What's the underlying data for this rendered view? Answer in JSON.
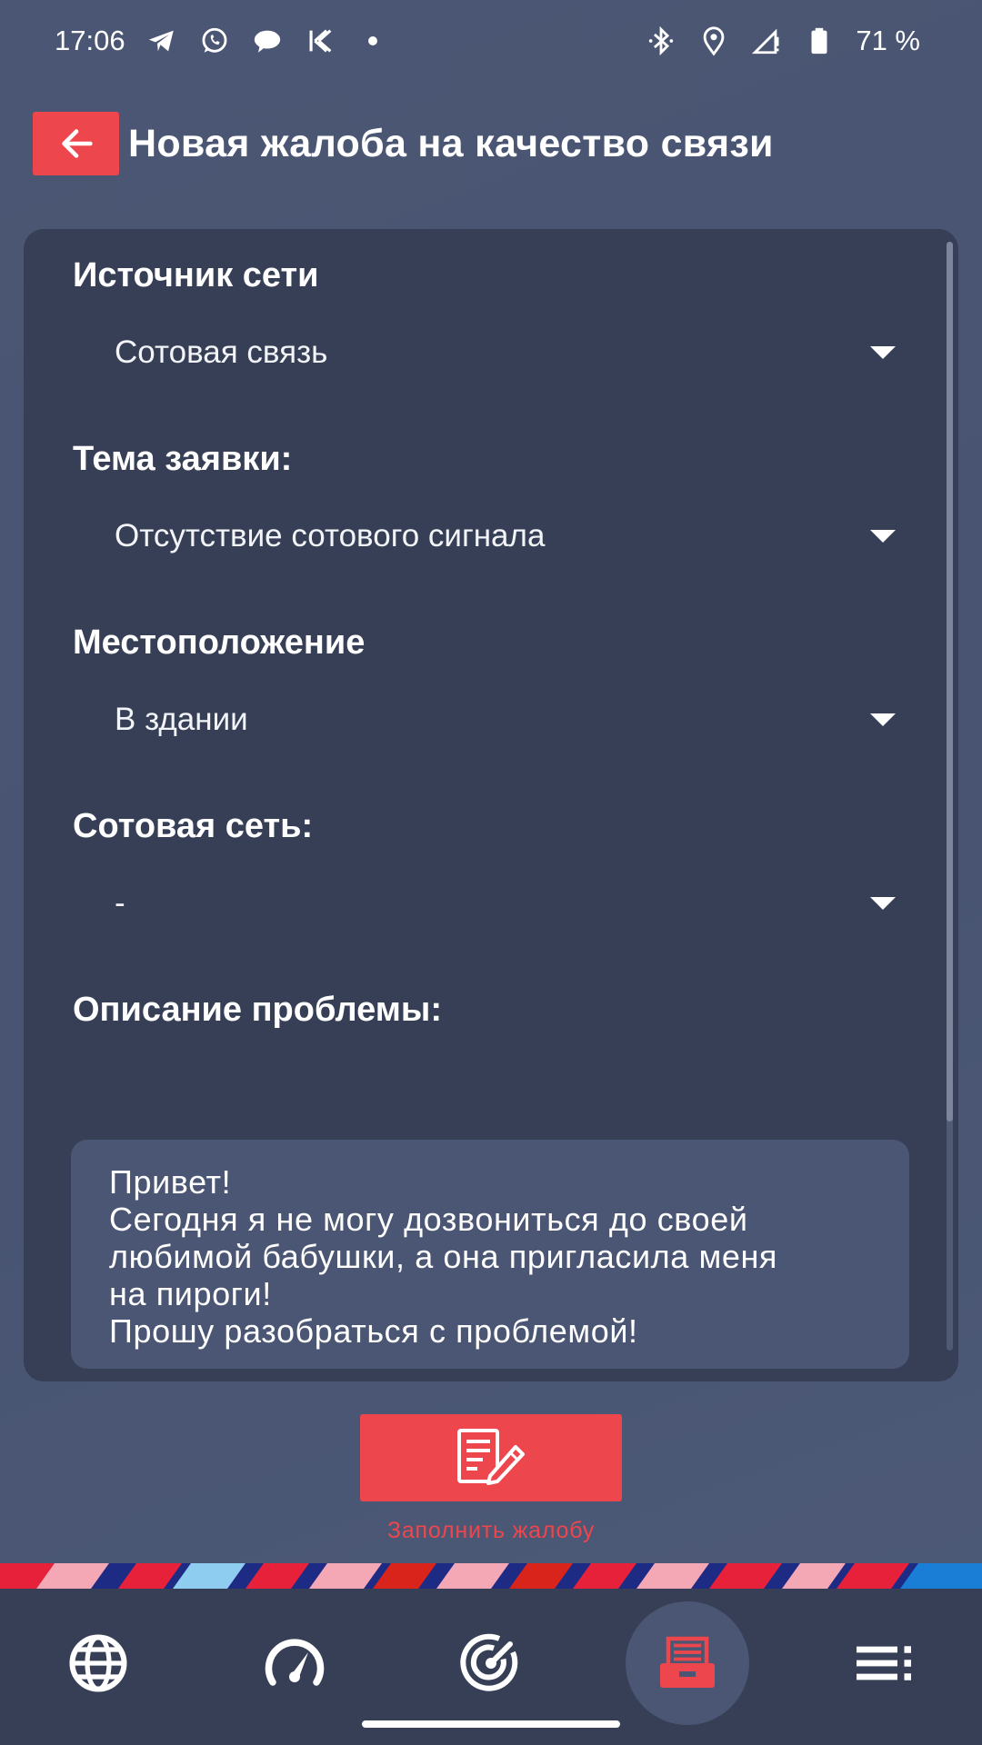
{
  "status_bar": {
    "time": "17:06",
    "left_icons": [
      "telegram-icon",
      "whatsapp-icon",
      "chat-bubble-icon",
      "k-icon",
      "dot-icon"
    ],
    "right_icons": [
      "bluetooth-icon",
      "location-icon",
      "signal-icon",
      "battery-icon"
    ],
    "battery": "71 %"
  },
  "header": {
    "title": "Новая жалоба на качество связи",
    "back_icon": "arrow-left-icon"
  },
  "form": {
    "network_source": {
      "label": "Источник сети",
      "value": "Сотовая связь"
    },
    "topic": {
      "label": "Тема заявки:",
      "value": "Отсутствие сотового сигнала"
    },
    "location": {
      "label": "Местоположение",
      "value": "В здании"
    },
    "cellular_network": {
      "label": "Сотовая сеть:",
      "value": "-"
    },
    "description": {
      "label": "Описание проблемы:",
      "lines": [
        "Привет!",
        "Сегодня я не могу дозвониться до своей",
        "любимой бабушки, а она пригласила меня",
        "на пироги!",
        "Прошу разобраться с проблемой!"
      ]
    }
  },
  "submit": {
    "caption": "Заполнить жалобу",
    "icon": "form-edit-icon"
  },
  "bottom_nav": {
    "items": [
      "globe-icon",
      "speedometer-icon",
      "radar-icon",
      "complaint-box-icon",
      "menu-list-icon"
    ],
    "active": "complaint-box-icon"
  },
  "colors": {
    "background": "#4a5673",
    "card": "#363f56",
    "accent": "#ee464d",
    "text": "#ffffff"
  }
}
